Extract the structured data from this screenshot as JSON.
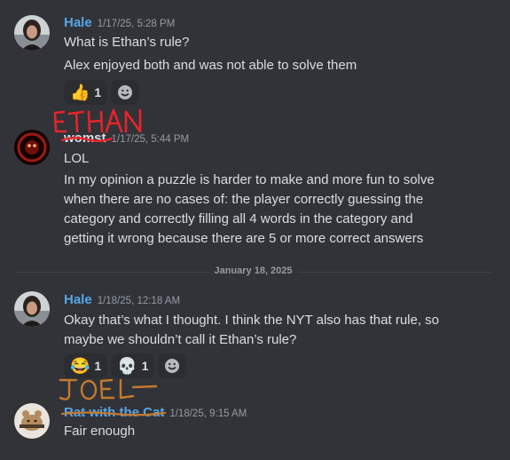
{
  "messages": [
    {
      "author": "Hale",
      "author_color": "#57a6e6",
      "timestamp": "1/17/25, 5:28 PM",
      "lines": [
        "What is Ethan’s rule?",
        "Alex enjoyed both and was not able to solve them"
      ],
      "reactions": [
        {
          "emoji": "👍",
          "count": "1"
        }
      ]
    },
    {
      "author": "womst",
      "author_color": "#dbdee1",
      "annotation": "ETHAN",
      "timestamp": "1/17/25, 5:44 PM",
      "lines": [
        "LOL",
        "In my opinion a puzzle is harder to make and more fun to solve",
        "when there are no cases of: the player correctly guessing the",
        "category and correctly filling all 4 words in the category and",
        "getting it wrong because there are 5 or more correct answers"
      ]
    },
    {
      "author": "Hale",
      "author_color": "#57a6e6",
      "timestamp": "1/18/25, 12:18 AM",
      "lines": [
        "Okay that’s what I thought. I think the NYT also has that rule, so",
        "maybe we shouldn’t call it Ethan’s rule?"
      ],
      "reactions": [
        {
          "emoji": "😂",
          "count": "1"
        },
        {
          "emoji": "💀",
          "count": "1"
        }
      ]
    },
    {
      "author": "Rat with the Cat",
      "author_color": "#57a6e6",
      "annotation": "JOEL",
      "timestamp": "1/18/25, 9:15 AM",
      "lines": [
        "Fair enough"
      ]
    }
  ],
  "date_divider": "January 18, 2025",
  "colors": {
    "background": "#313338",
    "annotation": "#e8242a",
    "link_name": "#57a6e6",
    "timestamp": "#949ba4"
  },
  "icons": {
    "add_reaction": "smile-icon"
  }
}
